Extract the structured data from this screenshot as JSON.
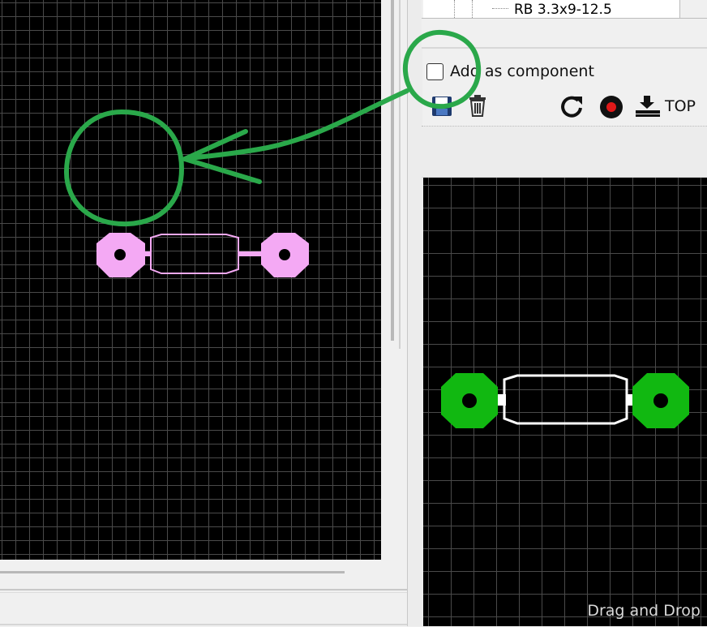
{
  "library_list": {
    "visible_item": "RB 3.3x9-12.5"
  },
  "options": {
    "add_as_component_label": "Add as component",
    "add_as_component_checked": false
  },
  "toolbar": {
    "save_icon": "save-icon",
    "delete_icon": "trash-icon",
    "rotate_icon": "rotate-icon",
    "record_icon": "record-icon",
    "layer_icon": "layer-top-icon",
    "layer_label": "TOP"
  },
  "preview": {
    "footer_text": "Drag and Drop"
  },
  "colors": {
    "canvas_bg": "#000000",
    "pad_selected": "#f4a9f4",
    "pad_preview": "#11b811",
    "annotation": "#2aa84a",
    "outline": "#ffffff"
  }
}
